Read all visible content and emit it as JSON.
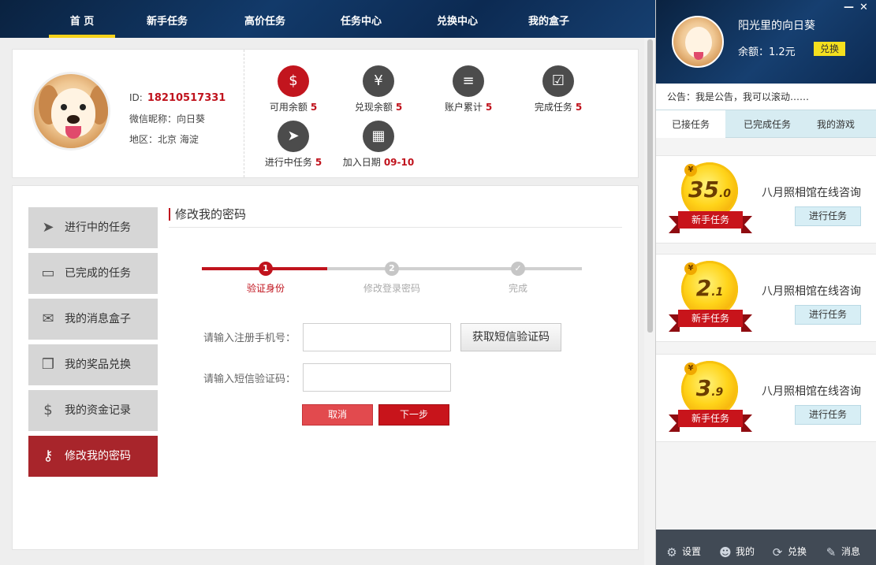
{
  "nav": {
    "items": [
      {
        "label": "首 页",
        "active": true
      },
      {
        "label": "新手任务"
      },
      {
        "label": "高价任务"
      },
      {
        "label": "任务中心"
      },
      {
        "label": "兑换中心"
      },
      {
        "label": "我的盒子"
      }
    ]
  },
  "profile": {
    "id_label": "ID:",
    "id_value": "18210517331",
    "wechat": "微信昵称：向日葵",
    "region": "地区：北京 海淀",
    "stats": [
      {
        "label": "可用余额",
        "value": "5",
        "icon": "dollar-icon"
      },
      {
        "label": "兑现余额",
        "value": "5",
        "icon": "yen-receipt-icon"
      },
      {
        "label": "账户累计",
        "value": "5",
        "icon": "coins-icon"
      },
      {
        "label": "完成任务",
        "value": "5",
        "icon": "check-icon"
      },
      {
        "label": "进行中任务",
        "value": "5",
        "icon": "paper-plane-icon"
      },
      {
        "label": "加入日期",
        "value": "09-10",
        "icon": "calendar-icon"
      }
    ]
  },
  "sidebar": {
    "items": [
      {
        "label": "进行中的任务",
        "icon": "paper-plane-icon"
      },
      {
        "label": "已完成的任务",
        "icon": "gamepad-icon"
      },
      {
        "label": "我的消息盒子",
        "icon": "inbox-icon"
      },
      {
        "label": "我的奖品兑换",
        "icon": "gift-icon"
      },
      {
        "label": "我的资金记录",
        "icon": "dollar-icon"
      },
      {
        "label": "修改我的密码",
        "icon": "key-icon",
        "active": true
      }
    ]
  },
  "form": {
    "title": "修改我的密码",
    "steps": [
      {
        "num": "1",
        "label": "验证身份",
        "active": true
      },
      {
        "num": "2",
        "label": "修改登录密码"
      },
      {
        "num": "✓",
        "label": "完成"
      }
    ],
    "progress": 0.33,
    "phone_label": "请输入注册手机号：",
    "phone_value": "",
    "code_label": "请输入短信验证码：",
    "code_value": "",
    "sms_button": "获取短信验证码",
    "cancel": "取消",
    "next": "下一步"
  },
  "right": {
    "username": "阳光里的向日葵",
    "balance": "余额：1.2元",
    "exchange": "兑换",
    "notice": "公告：我是公告，我可以滚动……",
    "tabs": [
      {
        "label": "已接任务",
        "active": true
      },
      {
        "label": "已完成任务"
      },
      {
        "label": "我的游戏"
      }
    ],
    "tasks": [
      {
        "amount_int": "35",
        "amount_dec": ".0",
        "badge": "新手任务",
        "name": "八月照相馆在线咨询",
        "action": "进行任务"
      },
      {
        "amount_int": "2",
        "amount_dec": ".1",
        "badge": "新手任务",
        "name": "八月照相馆在线咨询",
        "action": "进行任务"
      },
      {
        "amount_int": "3",
        "amount_dec": ".9",
        "badge": "新手任务",
        "name": "八月照相馆在线咨询",
        "action": "进行任务"
      }
    ],
    "footer": [
      {
        "label": "设置",
        "icon": "gear-icon"
      },
      {
        "label": "我的",
        "icon": "user-icon"
      },
      {
        "label": "兑换",
        "icon": "exchange-icon"
      },
      {
        "label": "消息",
        "icon": "chat-icon"
      }
    ]
  },
  "window": {
    "minimize": "—",
    "close": "✕"
  }
}
